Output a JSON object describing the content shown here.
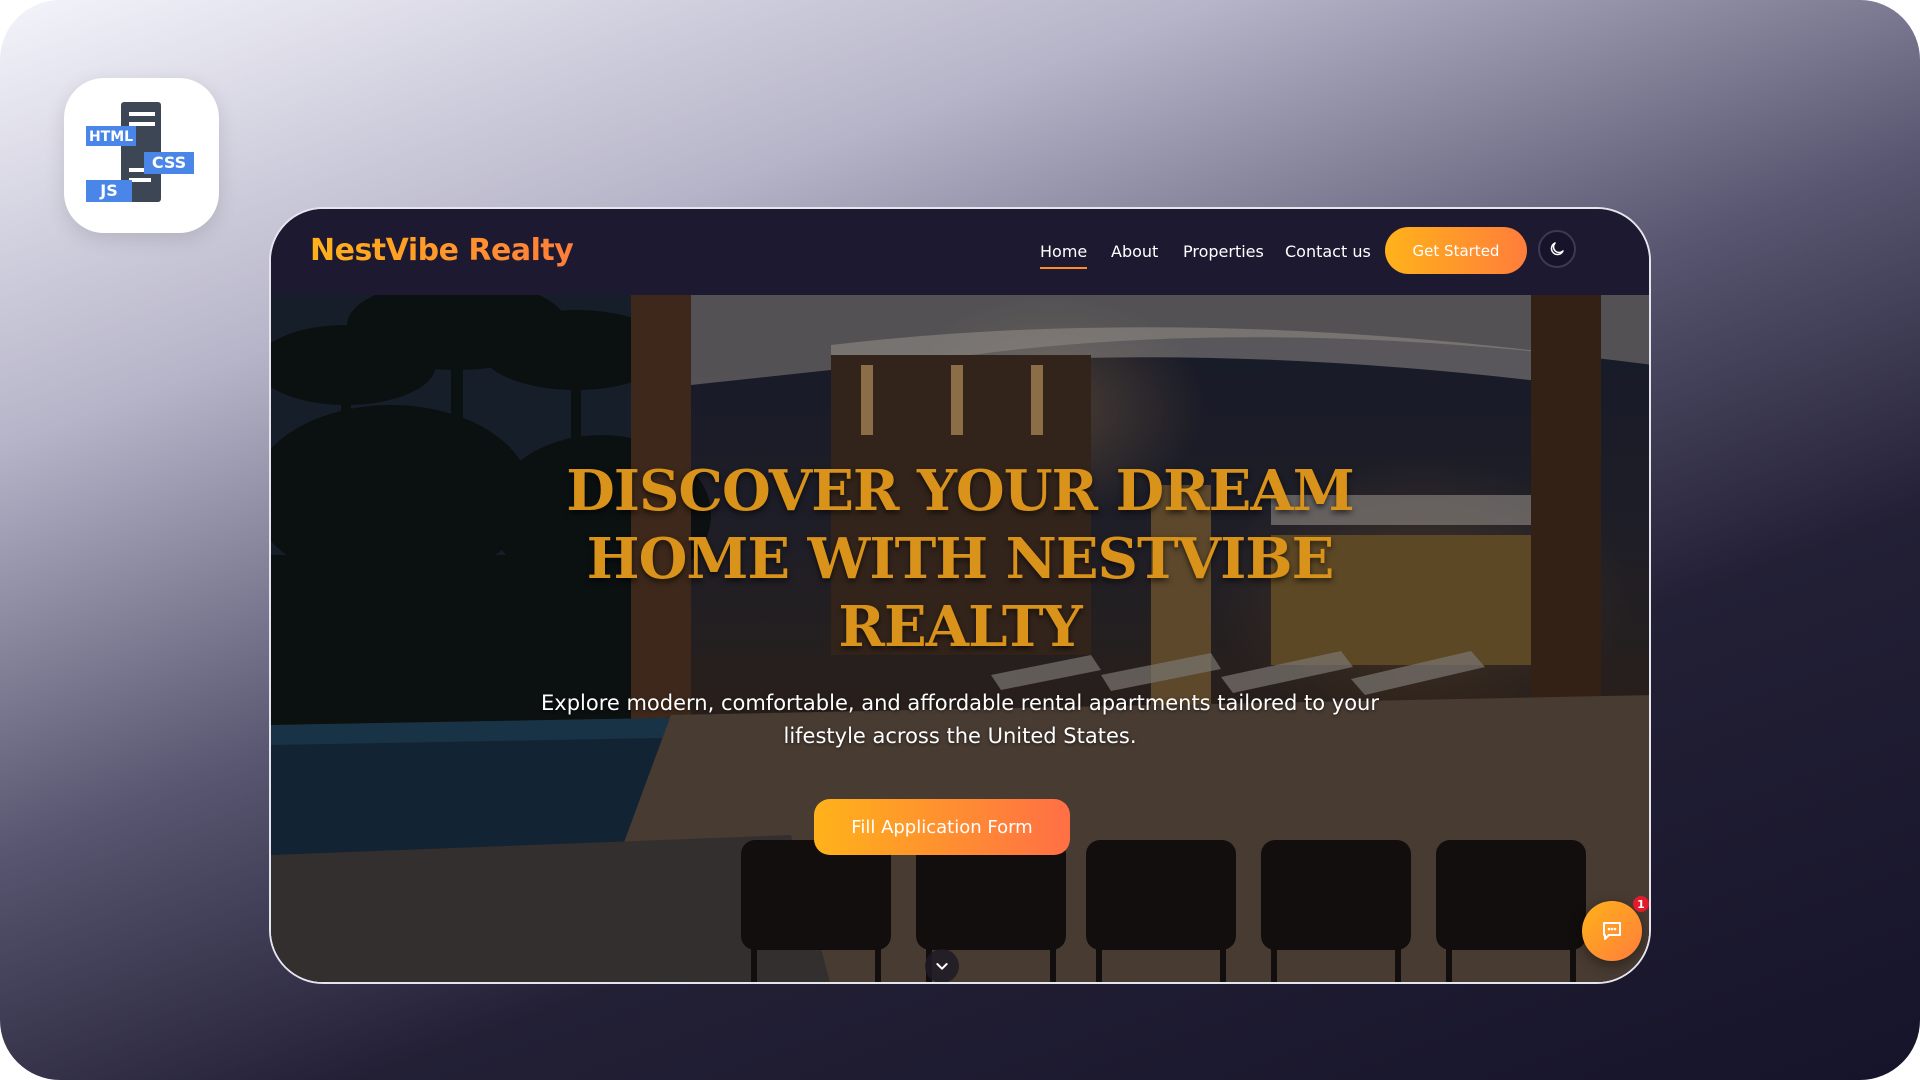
{
  "app_icon": {
    "html_label": "HTML",
    "css_label": "CSS",
    "js_label": "JS"
  },
  "navbar": {
    "logo": "NestVibe Realty",
    "links": [
      {
        "label": "Home",
        "active": true
      },
      {
        "label": "About",
        "active": false
      },
      {
        "label": "Properties",
        "active": false
      },
      {
        "label": "Contact us",
        "active": false
      }
    ],
    "cta_label": "Get Started",
    "theme_icon": "moon-icon"
  },
  "hero": {
    "title_lines": [
      "DISCOVER YOUR DREAM",
      "HOME WITH NESTVIBE",
      "REALTY"
    ],
    "subtitle_lines": [
      "Explore modern, comfortable, and affordable rental apartments tailored to your",
      "lifestyle across the United States."
    ],
    "cta_label": "Fill Application Form",
    "scroll_icon": "chevron-down-icon"
  },
  "chat": {
    "icon": "chat-icon",
    "badge_count": "1"
  },
  "colors": {
    "accent_start": "#ffb21a",
    "accent_end": "#ff7d3b",
    "title_gold": "#d9921a",
    "nav_bg": "#1c1930",
    "badge_red": "#e41b2a"
  }
}
